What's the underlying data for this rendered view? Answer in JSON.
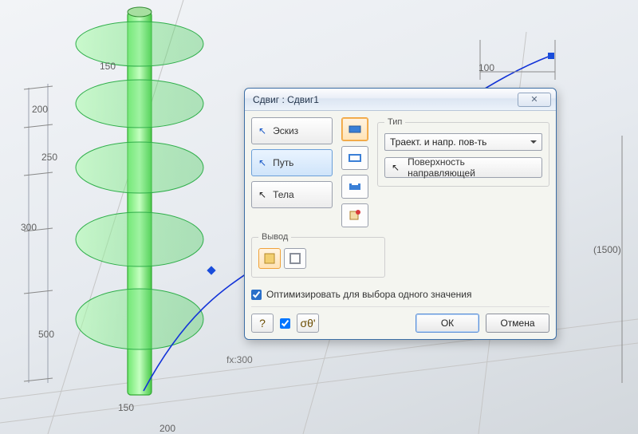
{
  "dialog": {
    "title": "Сдвиг : Сдвиг1",
    "close_label": "✕",
    "pick": {
      "sketch": "Эскиз",
      "path": "Путь",
      "bodies": "Тела"
    },
    "type_group": "Тип",
    "type_value": "Траект. и напр. пов-ть",
    "surface_btn": "Поверхность направляющей",
    "output_group": "Вывод",
    "optimize_label": "Оптимизировать для выбора одного значения",
    "ok_label": "ОК",
    "cancel_label": "Отмена",
    "help_glyph": "?",
    "and_glyph": "σθ'"
  },
  "dims": {
    "d150": "150",
    "d200": "200",
    "d250": "250",
    "d300": "300",
    "d500": "500",
    "d100": "100",
    "d1500": "(1500)",
    "fx300": "fx:300",
    "bottom150": "150",
    "bottom200": "200"
  }
}
